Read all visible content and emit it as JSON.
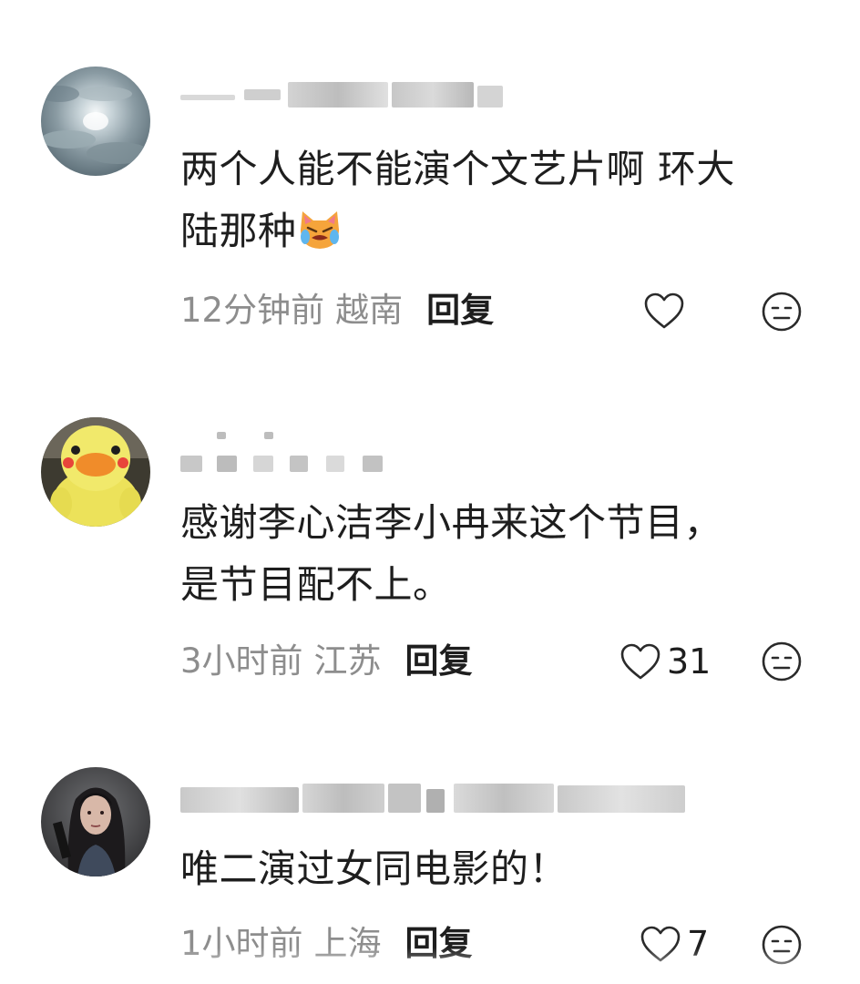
{
  "comments": [
    {
      "avatar": "sky-clouds-avatar",
      "username": "",
      "text_line1": "两个人能不能演个文艺片啊 环大",
      "text_line2": "陆那种",
      "emoji": "crying-cat-emoji",
      "time": "12分钟前",
      "location": "越南",
      "reply_label": "回复",
      "like_count": ""
    },
    {
      "avatar": "yellow-duck-plush-avatar",
      "username": "",
      "text_line1": "感谢李心洁李小冉来这个节目，",
      "text_line2": "是节目配不上。",
      "time": "3小时前",
      "location": "江苏",
      "reply_label": "回复",
      "like_count": "31"
    },
    {
      "avatar": "woman-portrait-avatar",
      "username": "",
      "text_line1": "唯二演过女同电影的！",
      "time": "1小时前",
      "location": "上海",
      "reply_label": "回复",
      "like_count": "7"
    }
  ],
  "colors": {
    "meta_gray": "#8d8d8d",
    "text_dark": "#1e1e1e",
    "icon_stroke": "#2a2a2a"
  }
}
